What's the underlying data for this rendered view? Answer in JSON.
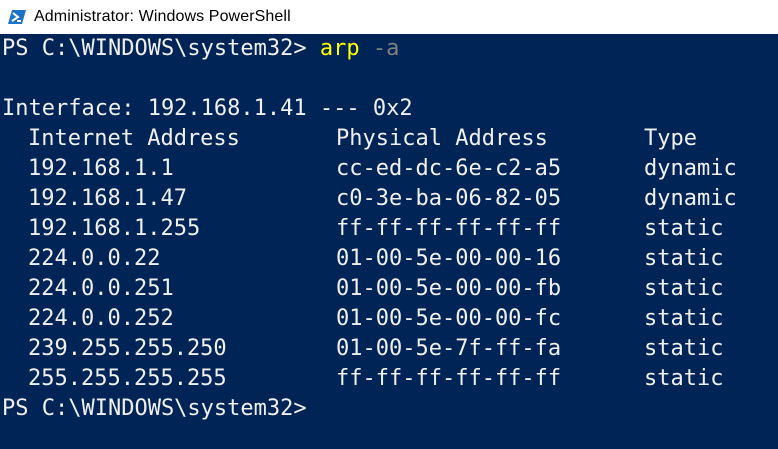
{
  "window": {
    "title": "Administrator: Windows PowerShell",
    "icon": "powershell-icon"
  },
  "console": {
    "prompt1": "PS C:\\WINDOWS\\system32> ",
    "command": "arp",
    "argument": "-a",
    "interface_line": "Interface: 192.168.1.41 --- 0x2",
    "headers": {
      "internet_address": "Internet Address",
      "physical_address": "Physical Address",
      "type": "Type"
    },
    "rows": [
      {
        "ip": "192.168.1.1",
        "mac": "cc-ed-dc-6e-c2-a5",
        "type": "dynamic"
      },
      {
        "ip": "192.168.1.47",
        "mac": "c0-3e-ba-06-82-05",
        "type": "dynamic"
      },
      {
        "ip": "192.168.1.255",
        "mac": "ff-ff-ff-ff-ff-ff",
        "type": "static"
      },
      {
        "ip": "224.0.0.22",
        "mac": "01-00-5e-00-00-16",
        "type": "static"
      },
      {
        "ip": "224.0.0.251",
        "mac": "01-00-5e-00-00-fb",
        "type": "static"
      },
      {
        "ip": "224.0.0.252",
        "mac": "01-00-5e-00-00-fc",
        "type": "static"
      },
      {
        "ip": "239.255.255.250",
        "mac": "01-00-5e-7f-ff-fa",
        "type": "static"
      },
      {
        "ip": "255.255.255.255",
        "mac": "ff-ff-ff-ff-ff-ff",
        "type": "static"
      }
    ],
    "prompt2": "PS C:\\WINDOWS\\system32>"
  },
  "colors": {
    "background": "#012456",
    "text": "#f0f0f0",
    "command": "#ffff00",
    "argument": "#808080"
  }
}
